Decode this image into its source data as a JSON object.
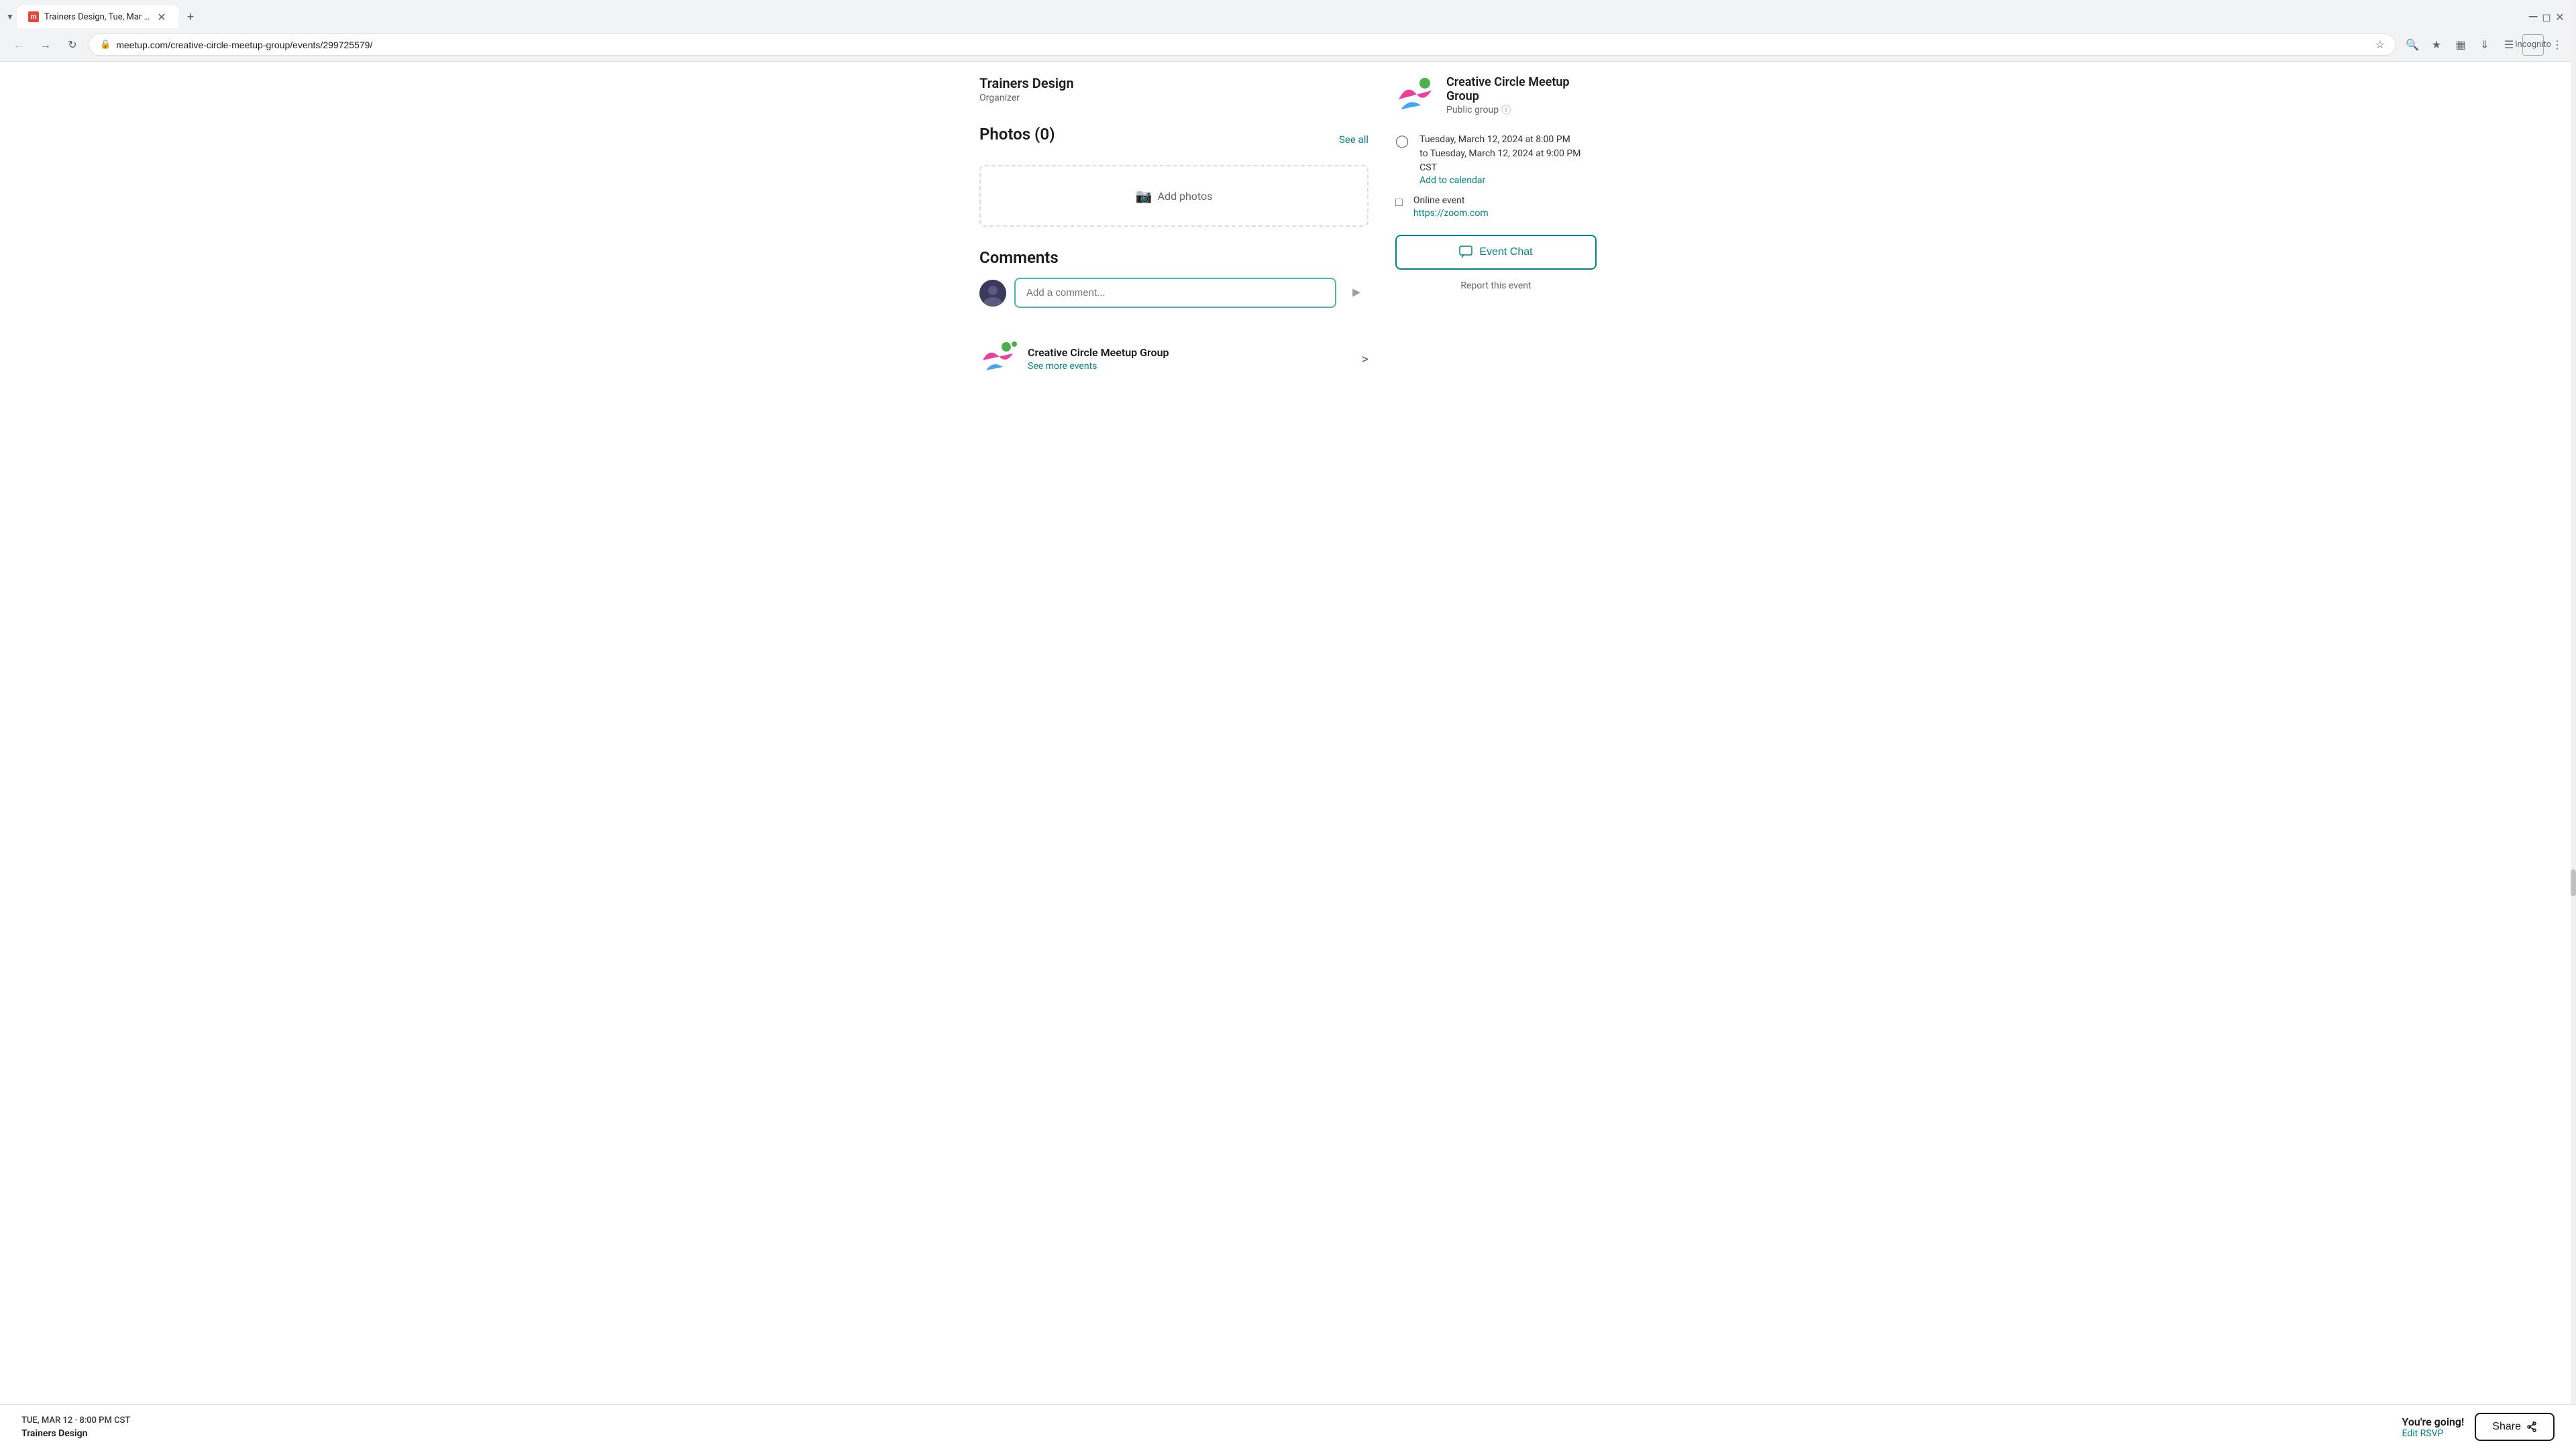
{
  "browser": {
    "tab": {
      "title": "Trainers Design, Tue, Mar 12, 2...",
      "favicon_color": "#e8453c"
    },
    "address": "meetup.com/creative-circle-meetup-group/events/299725579/",
    "mode": "Incognito"
  },
  "organizer": {
    "name": "Trainers Design",
    "label": "Organizer"
  },
  "photos": {
    "title": "Photos (0)",
    "see_all": "See all",
    "add_photos": "Add photos"
  },
  "comments": {
    "title": "Comments",
    "placeholder": "Add a comment..."
  },
  "group": {
    "name": "Creative Circle Meetup Group",
    "see_more": "See more events",
    "type": "Public group"
  },
  "sidebar": {
    "group_name": "Creative Circle Meetup Group",
    "group_type": "Public group",
    "date_time": "Tuesday, March 12, 2024 at 8:00 PM",
    "date_time_end": "to Tuesday, March 12, 2024 at 9:00 PM CST",
    "add_to_calendar": "Add to calendar",
    "event_type": "Online event",
    "event_link": "https://zoom.com",
    "event_chat_label": "Event Chat",
    "report": "Report this event"
  },
  "bottom_bar": {
    "date": "TUE, MAR 12 · 8:00 PM CST",
    "title": "Trainers Design",
    "going_label": "You're going!",
    "edit_rsvp": "Edit RSVP",
    "share": "Share"
  }
}
